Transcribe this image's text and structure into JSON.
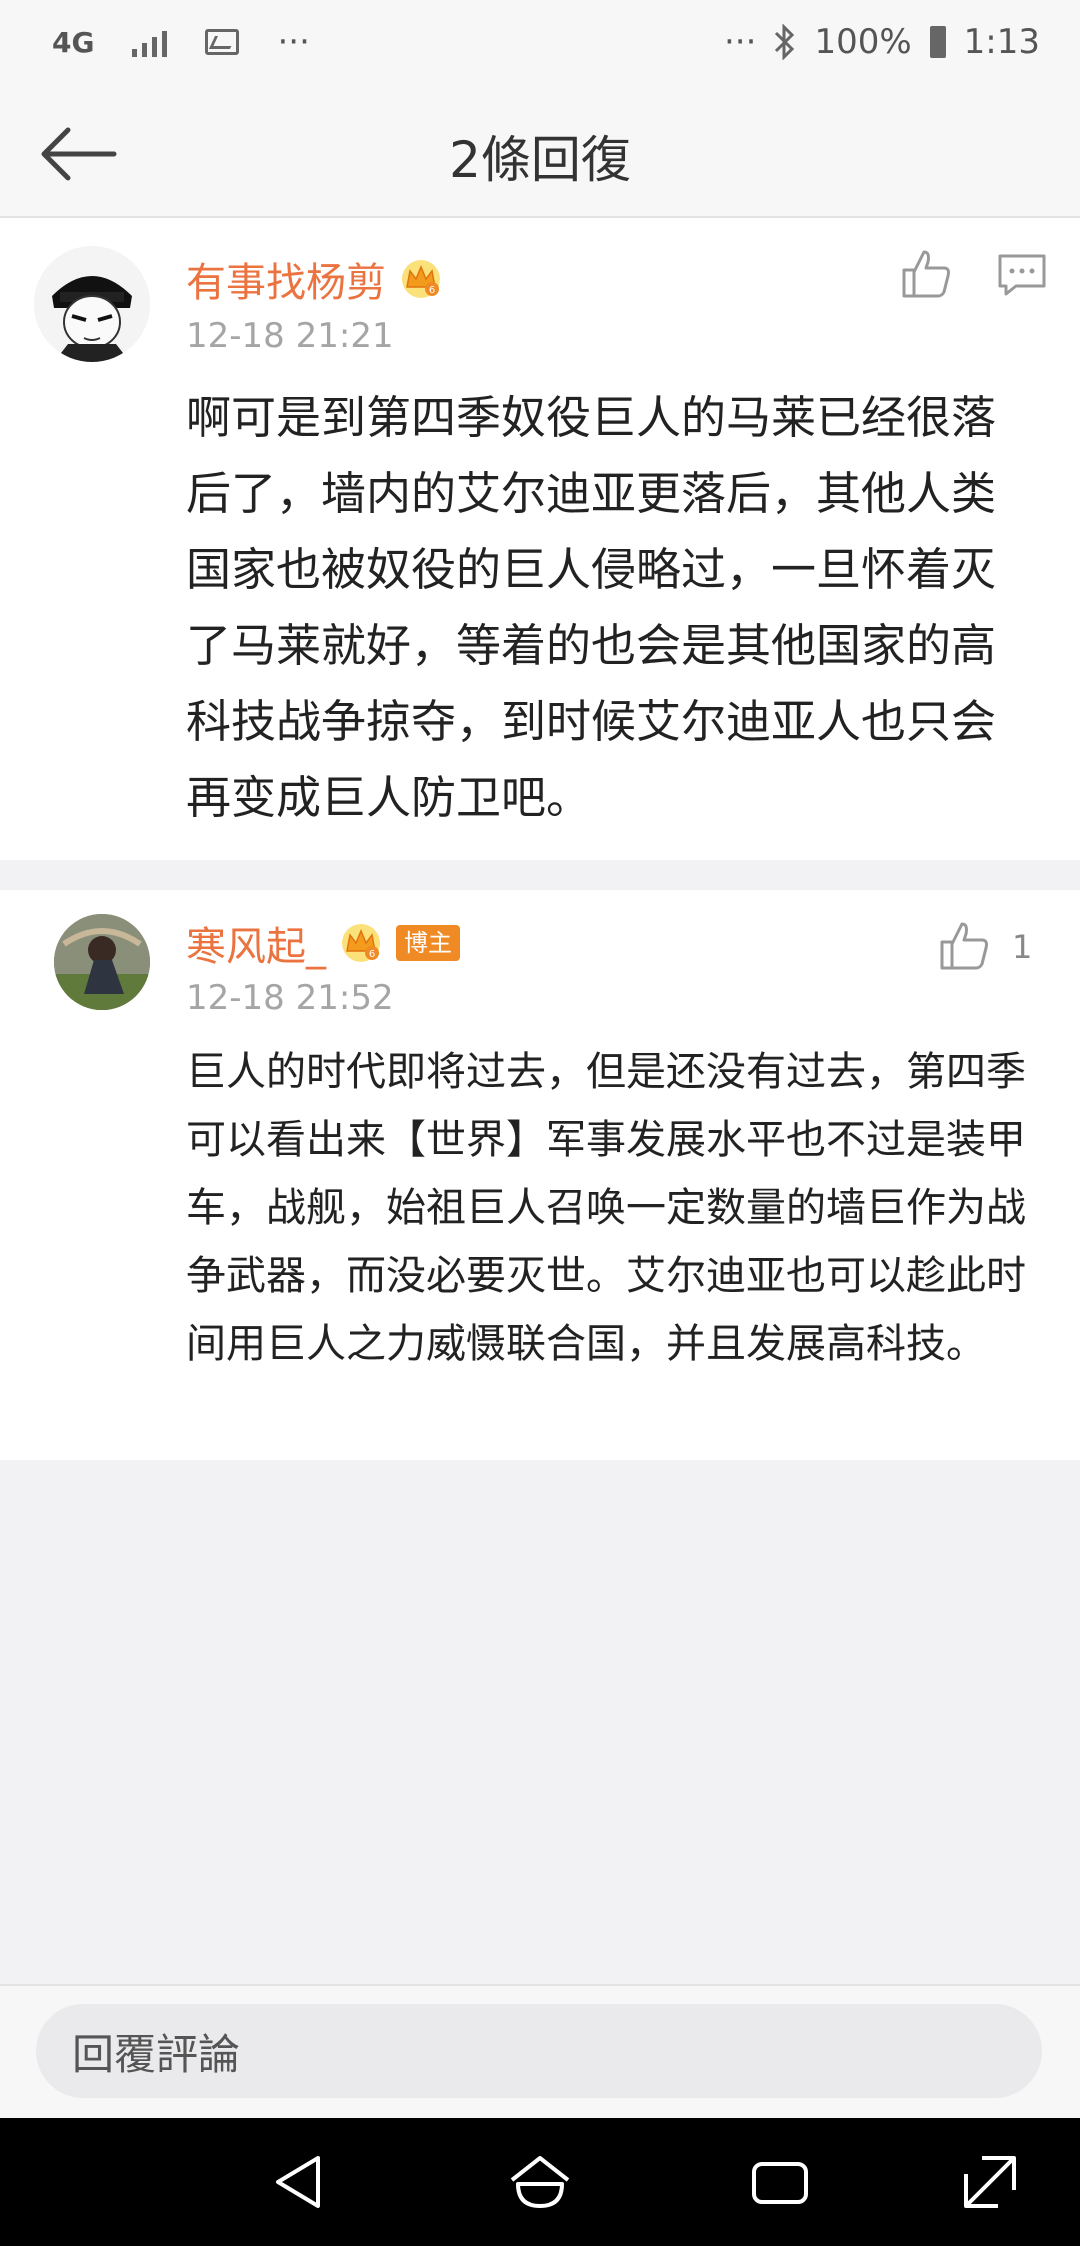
{
  "status_bar": {
    "network": "4G",
    "more": "···",
    "right_more": "···",
    "battery": "100%",
    "time": "1:13"
  },
  "header": {
    "title": "2條回復"
  },
  "comments": [
    {
      "username": "有事找杨剪",
      "time": "12-18 21:21",
      "text": "啊可是到第四季奴役巨人的马莱已经很落后了，墙内的艾尔迪亚更落后，其他人类国家也被奴役的巨人侵略过，一旦怀着灭了马莱就好，等着的也会是其他国家的高科技战争掠夺，到时候艾尔迪亚人也只会再变成巨人防卫吧。"
    },
    {
      "username": "寒风起_",
      "badge": "博主",
      "time": "12-18 21:52",
      "likes": "1",
      "text": "巨人的时代即将过去，但是还没有过去，第四季可以看出来【世界】军事发展水平也不过是装甲车，战舰，始祖巨人召唤一定数量的墙巨作为战争武器，而没必要灭世。艾尔迪亚也可以趁此时间用巨人之力威慑联合国，并且发展高科技。"
    }
  ],
  "reply_bar": {
    "placeholder": "回覆評論"
  },
  "colors": {
    "username": "#eb7340",
    "badge": "#f08a24",
    "background": "#f2f2f4"
  }
}
